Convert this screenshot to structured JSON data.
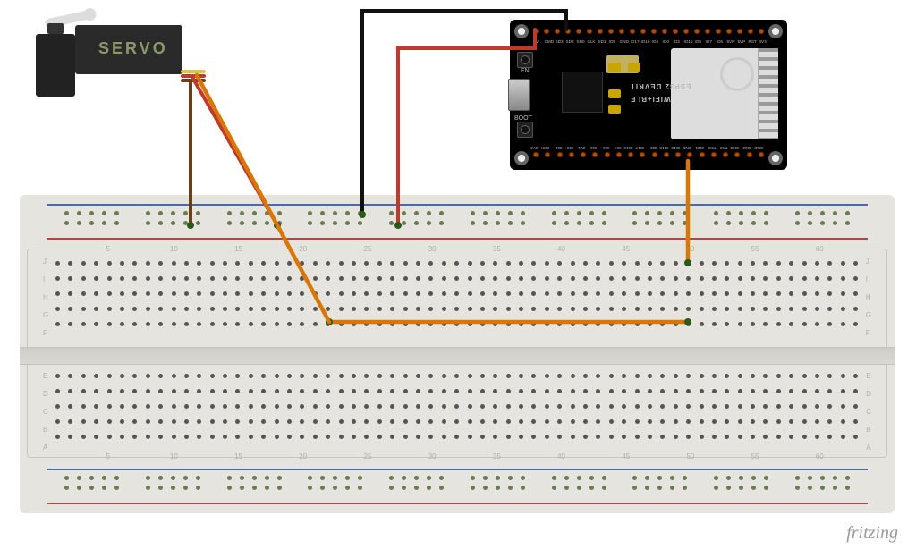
{
  "servo": {
    "label": "SERVO",
    "wire_colors": [
      "signal-yellow",
      "power-red",
      "ground-brown"
    ]
  },
  "board": {
    "name": "ESP32 DEVKIT",
    "subtitle": "WIFI+BLE",
    "buttons": {
      "en": "EN",
      "boot": "BOOT"
    },
    "usb": "micro-USB",
    "pins_top": [
      "5V",
      "CMD",
      "SD3",
      "SD2",
      "SD0",
      "CLK",
      "SD1",
      "IO5",
      "GND",
      "IO17",
      "IO16",
      "IO4",
      "IO0",
      "IO2",
      "IO15",
      "IO8",
      "IO7",
      "IO6",
      "5VN",
      "5VP",
      "RST",
      "3V3"
    ],
    "pins_bot": [
      "3V3",
      "SCK",
      "IO1",
      "IO3",
      "3V1",
      "IO2",
      "IO0",
      "IO4",
      "IO16",
      "IO17",
      "IO5",
      "IO18",
      "IO19",
      "GND",
      "IO21",
      "RX0",
      "TX0",
      "IO22",
      "IO23",
      "GND"
    ]
  },
  "breadboard": {
    "columns": 63,
    "rows_top": [
      "J",
      "I",
      "H",
      "G",
      "F"
    ],
    "rows_bot": [
      "E",
      "D",
      "C",
      "B",
      "A"
    ],
    "rail_labels": [
      "+",
      "−"
    ]
  },
  "wiring": [
    {
      "name": "servo-ground",
      "from": "servo.gnd",
      "to": "breadboard.rail_top_neg",
      "color": "brown"
    },
    {
      "name": "servo-power",
      "from": "servo.vcc",
      "to": "breadboard.rail_top_pos",
      "color": "red"
    },
    {
      "name": "servo-signal",
      "from": "servo.sig",
      "to": "breadboard.F47 via F25",
      "color": "orange"
    },
    {
      "name": "esp32-5v",
      "from": "esp32.5V",
      "to": "breadboard.rail_top_pos",
      "color": "red"
    },
    {
      "name": "esp32-gnd",
      "from": "esp32.GND",
      "to": "breadboard.rail_top_neg",
      "color": "black"
    },
    {
      "name": "esp32-io19",
      "from": "esp32.IO19",
      "to": "breadboard.J47",
      "color": "orange"
    }
  ],
  "footer": {
    "credit": "fritzing"
  }
}
